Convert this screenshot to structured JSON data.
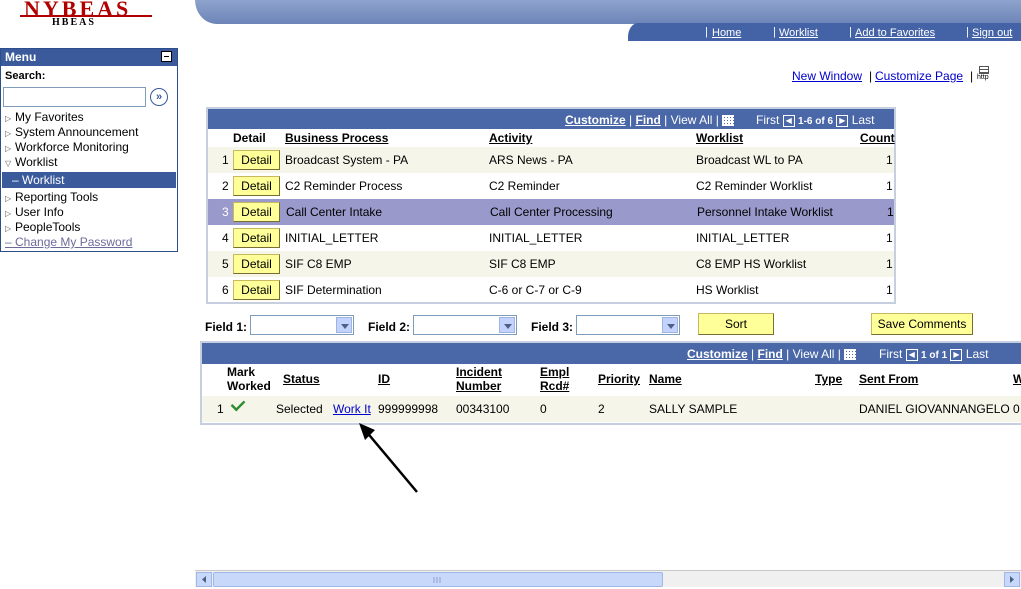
{
  "logo": {
    "title": "NYBEAS",
    "subtitle": "HBEAS"
  },
  "header": {
    "links": [
      "Home",
      "Worklist",
      "Add to Favorites",
      "Sign out"
    ]
  },
  "menu": {
    "title": "Menu",
    "search_label": "Search:",
    "items": [
      "My Favorites",
      "System Announcement",
      "Workforce Monitoring",
      "Worklist",
      "– Worklist",
      "Reporting Tools",
      "User Info",
      "PeopleTools",
      "– Change My Password"
    ]
  },
  "page_links": {
    "new_window": "New Window",
    "customize_page": "Customize Page",
    "http_icon_label": "http"
  },
  "grid1": {
    "toolbar": {
      "customize": "Customize",
      "find": "Find",
      "view_all": "View All",
      "first": "First",
      "range": "1-6 of 6",
      "last": "Last"
    },
    "headers": {
      "detail": "Detail",
      "business_process": "Business Process",
      "activity": "Activity",
      "worklist": "Worklist",
      "count": "Count"
    },
    "detail_label": "Detail",
    "rows": [
      {
        "num": "1",
        "bp": "Broadcast System - PA",
        "activity": "ARS News - PA",
        "worklist": "Broadcast WL to PA",
        "count": "1"
      },
      {
        "num": "2",
        "bp": "C2 Reminder Process",
        "activity": "C2 Reminder",
        "worklist": "C2 Reminder Worklist",
        "count": "1"
      },
      {
        "num": "3",
        "bp": "Call Center Intake",
        "activity": "Call Center Processing",
        "worklist": "Personnel Intake Worklist",
        "count": "1"
      },
      {
        "num": "4",
        "bp": "INITIAL_LETTER",
        "activity": "INITIAL_LETTER",
        "worklist": "INITIAL_LETTER",
        "count": "1"
      },
      {
        "num": "5",
        "bp": "SIF C8 EMP",
        "activity": "SIF C8 EMP",
        "worklist": "C8 EMP HS Worklist",
        "count": "1"
      },
      {
        "num": "6",
        "bp": "SIF Determination",
        "activity": "C-6 or C-7 or C-9",
        "worklist": "HS Worklist",
        "count": "1"
      }
    ]
  },
  "fields": {
    "field1": "Field 1:",
    "field2": "Field 2:",
    "field3": "Field 3:",
    "sort": "Sort",
    "save_comments": "Save Comments"
  },
  "grid2": {
    "toolbar": {
      "customize": "Customize",
      "find": "Find",
      "view_all": "View All",
      "first": "First",
      "range": "1 of 1",
      "last": "Last"
    },
    "headers": {
      "mark_line1": "Mark",
      "mark_line2": "Worked",
      "status": "Status",
      "id": "ID",
      "incident_line1": "Incident",
      "incident_line2": "Number",
      "empl_line1": "Empl",
      "empl_line2": "Rcd#",
      "priority": "Priority",
      "name": "Name",
      "type": "Type",
      "sent_from": "Sent From",
      "truncated": "W"
    },
    "row": {
      "num": "1",
      "status": "Selected",
      "work_it": "Work It",
      "id": "999999998",
      "incident": "00343100",
      "empl_rcd": "0",
      "priority": "2",
      "name": "SALLY SAMPLE",
      "sent_from": "DANIEL GIOVANNANGELO",
      "truncated": "0"
    }
  }
}
